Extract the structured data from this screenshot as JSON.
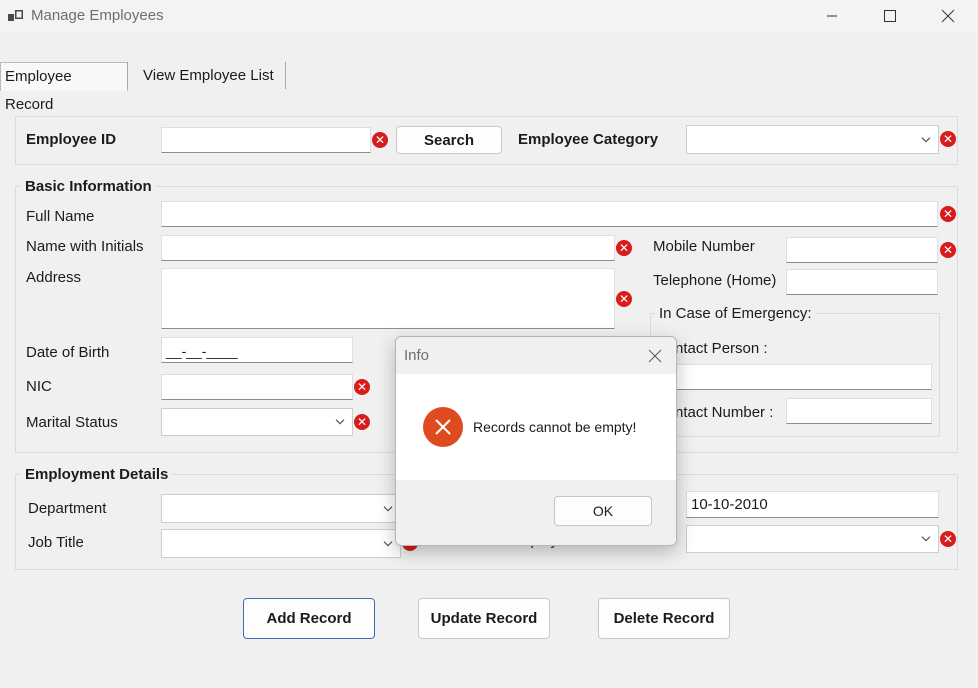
{
  "window": {
    "title": "Manage Employees"
  },
  "tabs": [
    {
      "label": "Employee Record"
    },
    {
      "label": "View Employee List"
    }
  ],
  "search": {
    "employee_id_label": "Employee ID",
    "employee_id_value": "",
    "search_button": "Search",
    "category_label": "Employee Category",
    "category_value": ""
  },
  "basic": {
    "group_title": "Basic Information",
    "full_name_label": "Full Name",
    "name_initials_label": "Name with Initials",
    "address_label": "Address",
    "dob_label": "Date of Birth",
    "dob_value": "__-__-____",
    "nic_label": "NIC",
    "marital_label": "Marital Status",
    "mobile_label": "Mobile Number",
    "telephone_label": "Telephone (Home)",
    "emergency_title": "In Case of Emergency:",
    "contact_person_label": "ntact Person :",
    "contact_number_label": "ntact Number :"
  },
  "employment": {
    "group_title": "Employment Details",
    "department_label": "Department",
    "job_title_label": "Job Title",
    "date_value": "10-10-2010",
    "status_label": "Employment Status"
  },
  "actions": {
    "add": "Add Record",
    "update": "Update Record",
    "delete": "Delete Record"
  },
  "dialog": {
    "title": "Info",
    "message": "Records cannot be empty!",
    "ok": "OK"
  },
  "colors": {
    "error": "#d81c1c",
    "accent_border": "#3d6fb0",
    "dialog_icon": "#e04a1f"
  }
}
